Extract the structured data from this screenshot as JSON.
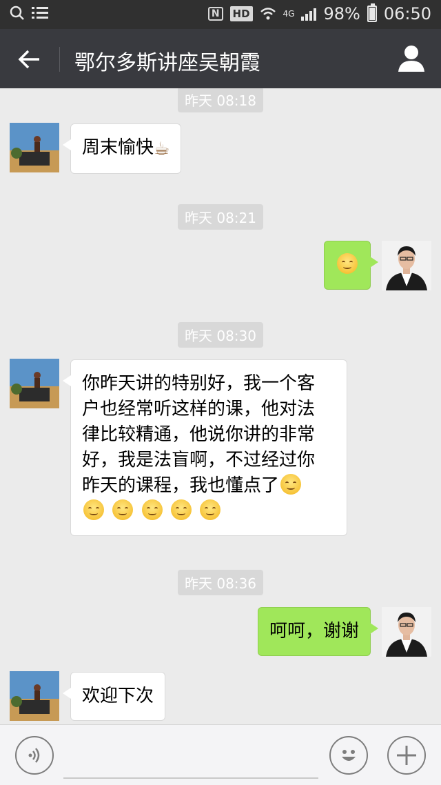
{
  "status_bar": {
    "nfc": "N",
    "hd": "HD",
    "network": "4G",
    "battery": "98%",
    "time": "06:50"
  },
  "header": {
    "title": "鄂尔多斯讲座吴朝霞"
  },
  "messages": [
    {
      "time": "昨天 08:18"
    },
    {
      "side": "left",
      "text": "周末愉快"
    },
    {
      "time": "昨天 08:21"
    },
    {
      "side": "right",
      "text": ""
    },
    {
      "time": "昨天 08:30"
    },
    {
      "side": "left",
      "lines": [
        "你昨天讲的特别好，我一个客",
        "户也经常听这样的课，他对法",
        "律比较精通，他说你讲的非常",
        "好，我是法盲啊，不过经过你",
        "昨天的课程，我也懂点了"
      ]
    },
    {
      "time": "昨天 08:36"
    },
    {
      "side": "right",
      "text": "呵呵，谢谢"
    },
    {
      "side": "left",
      "text": "欢迎下次"
    }
  ],
  "colors": {
    "status_bg": "#303030",
    "nav_bg": "#393a3f",
    "chat_bg": "#ebebeb",
    "sent_bubble": "#a0e75a",
    "received_bubble": "#ffffff"
  },
  "icons": {
    "back": "arrow-left-icon",
    "profile": "person-icon",
    "voice": "voice-icon",
    "emoji": "smiley-icon",
    "plus": "plus-icon"
  }
}
